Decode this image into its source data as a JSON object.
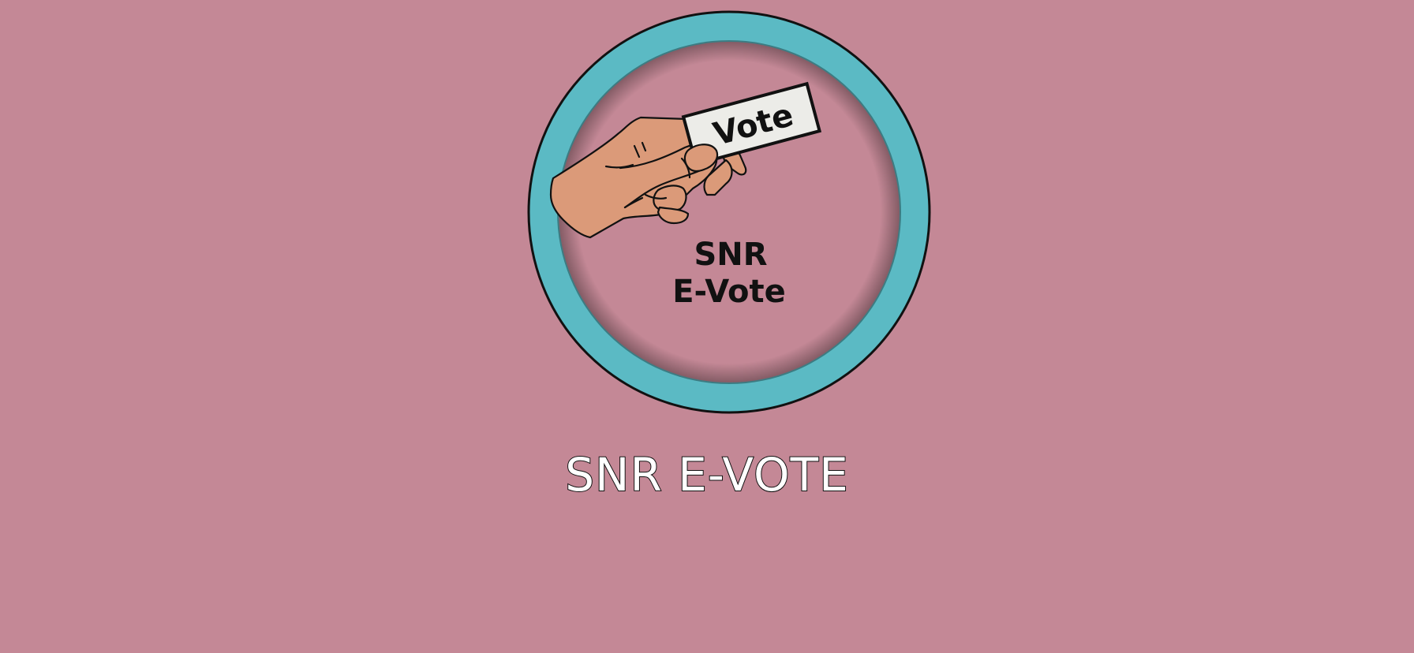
{
  "theme": {
    "background": "#C48896",
    "ring_color": "#5BBAC4",
    "inner_disc": "#C48896",
    "skin": "#DB9A79",
    "card": "#ECECE8",
    "outline": "#111111",
    "title_fill": "#FFFFFF"
  },
  "logo": {
    "card_text": "Vote",
    "brand_line1": "SNR",
    "brand_line2": "E-Vote",
    "icons": [
      "hand-icon",
      "ballot-card-icon"
    ]
  },
  "title": "SNR E-VOTE"
}
